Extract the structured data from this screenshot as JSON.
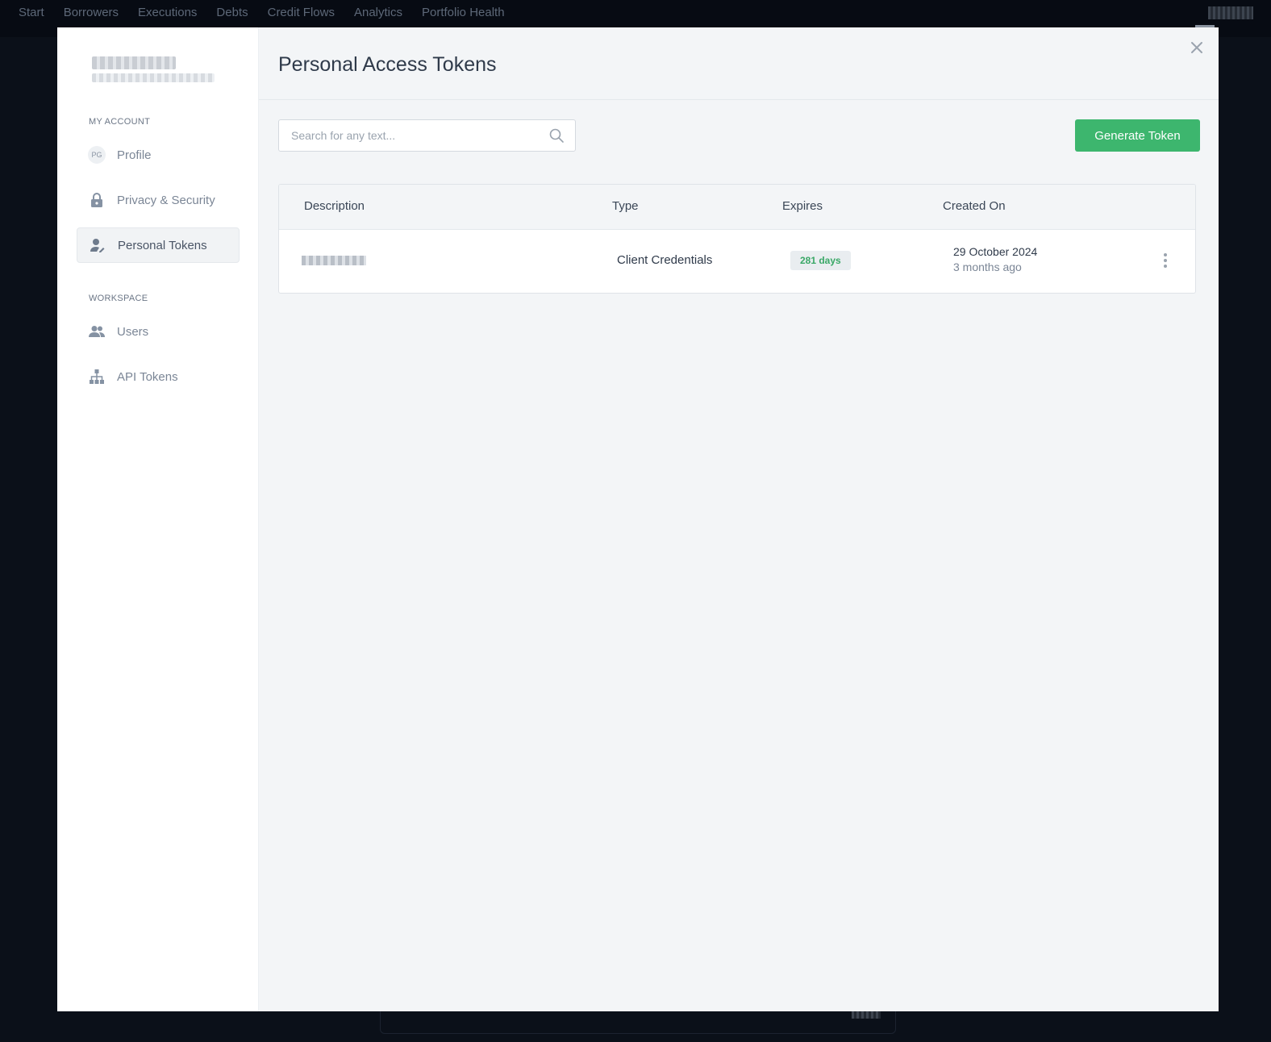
{
  "topnav": {
    "items": [
      "Start",
      "Borrowers",
      "Executions",
      "Debts",
      "Credit Flows",
      "Analytics",
      "Portfolio Health"
    ]
  },
  "sidebar": {
    "sections": [
      {
        "label": "MY ACCOUNT"
      },
      {
        "label": "WORKSPACE"
      }
    ],
    "items": [
      {
        "label": "Profile",
        "icon": "avatar-initials",
        "initials": "PG"
      },
      {
        "label": "Privacy & Security",
        "icon": "lock-icon"
      },
      {
        "label": "Personal Tokens",
        "icon": "user-key-icon",
        "active": true
      },
      {
        "label": "Users",
        "icon": "users-icon"
      },
      {
        "label": "API Tokens",
        "icon": "sitemap-icon"
      }
    ]
  },
  "main": {
    "title": "Personal Access Tokens",
    "search_placeholder": "Search for any text...",
    "generate_label": "Generate Token",
    "table": {
      "headers": [
        "Description",
        "Type",
        "Expires",
        "Created On"
      ],
      "rows": [
        {
          "type": "Client Credentials",
          "expires": "281 days",
          "created_date": "29 October 2024",
          "created_relative": "3 months ago"
        }
      ]
    }
  },
  "colors": {
    "accent_green": "#3db66e",
    "badge_text": "#3aa867",
    "overlay_bg": "#0b1019"
  }
}
